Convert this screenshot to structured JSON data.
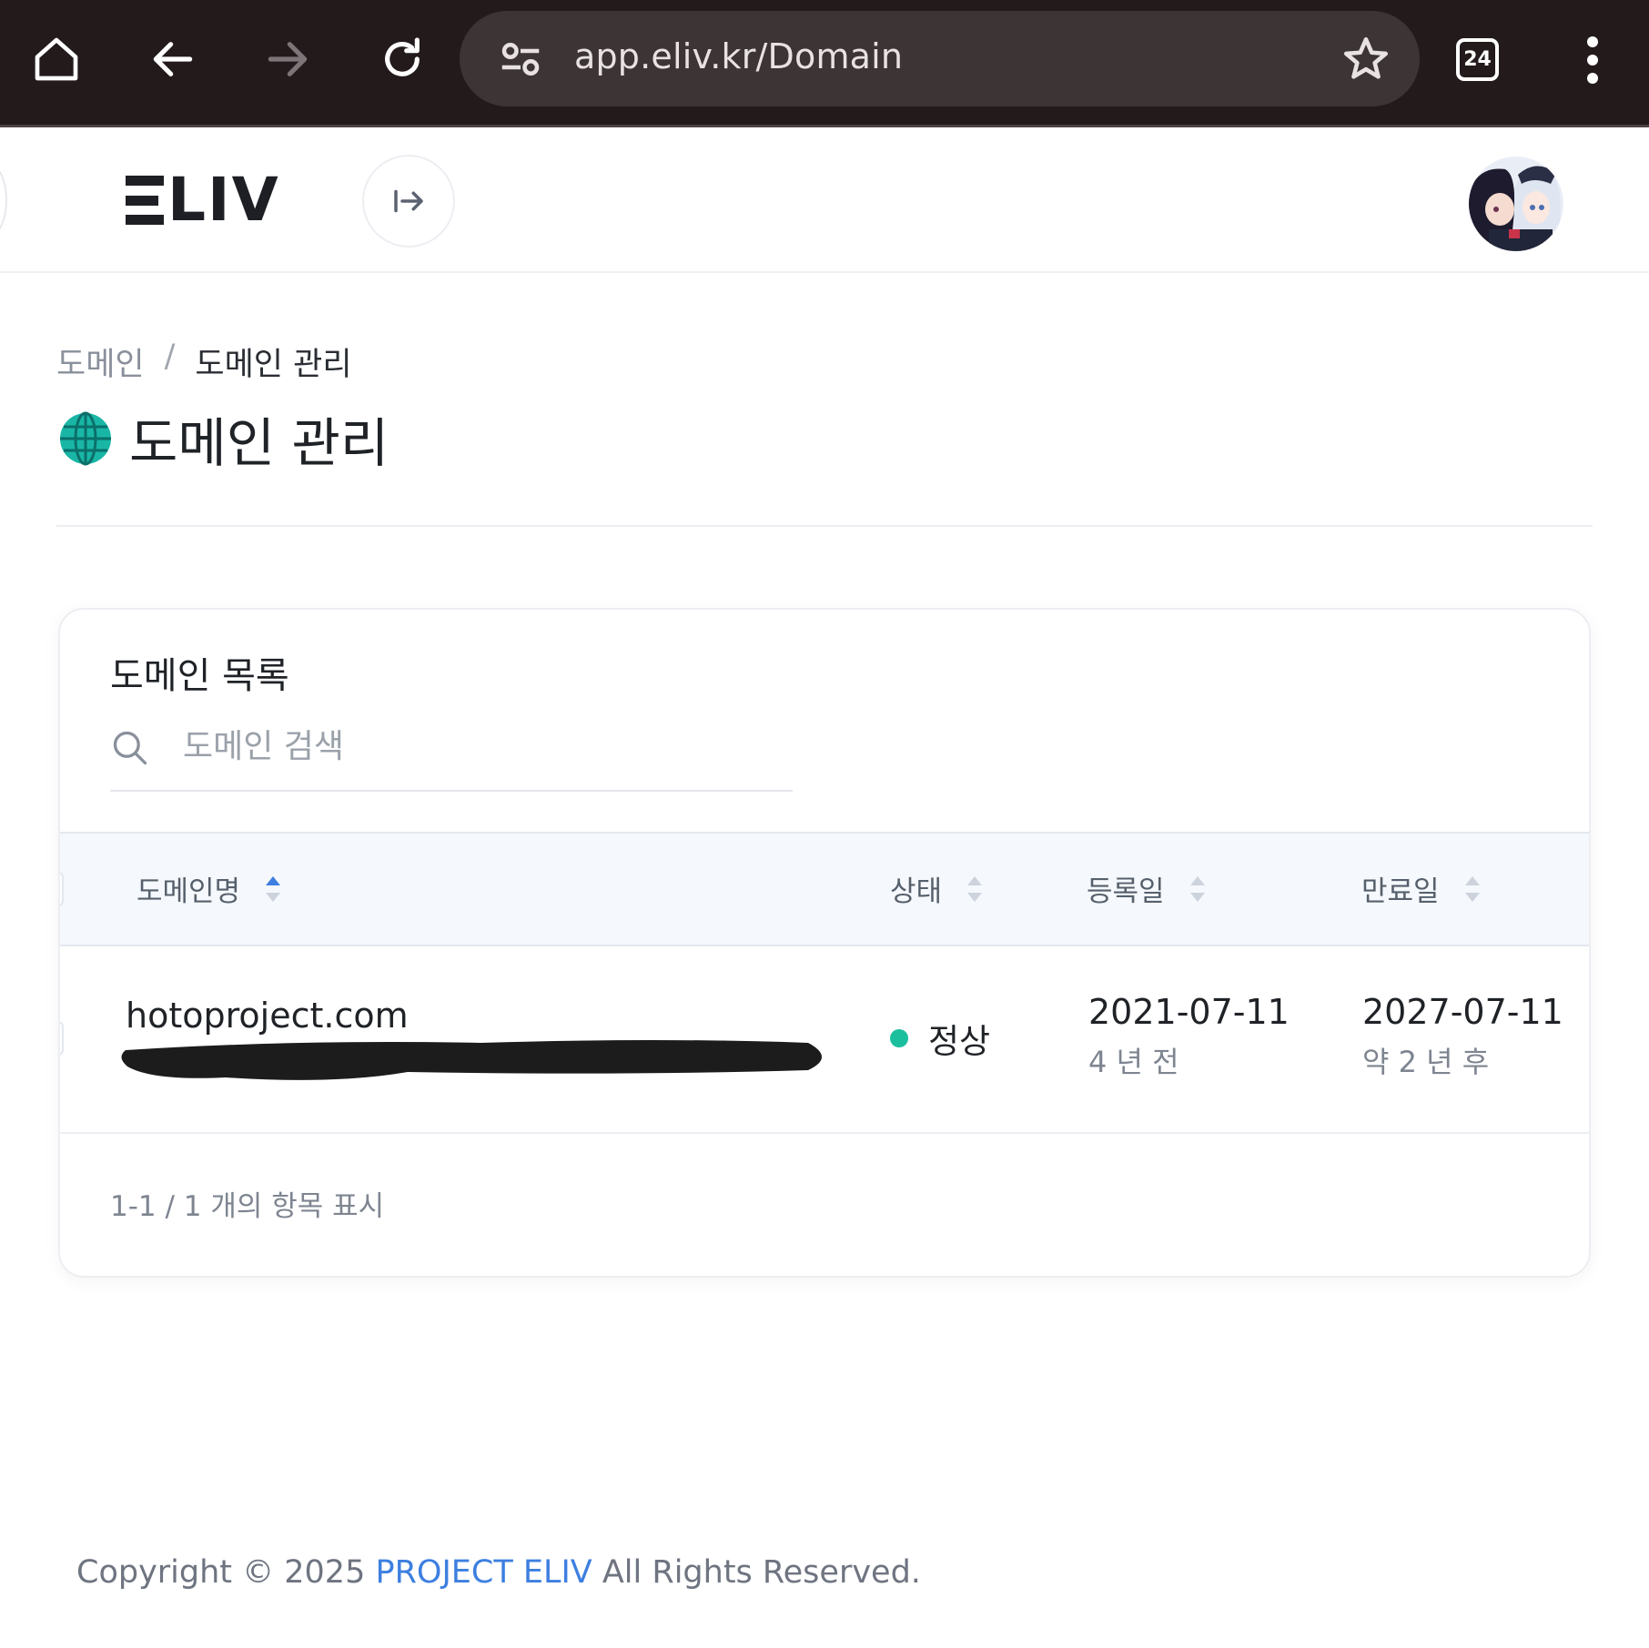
{
  "browser": {
    "url": "app.eliv.kr/Domain",
    "tab_count": "24",
    "icons": [
      "home-icon",
      "back-icon",
      "forward-icon",
      "reload-icon",
      "site-settings-icon",
      "bookmark-star-icon",
      "tabs-icon",
      "menu-kebab-icon"
    ]
  },
  "header": {
    "logo_text": "LIV",
    "logo_aria": "ELIV"
  },
  "breadcrumb": {
    "parent": "도메인",
    "separator": "/",
    "current": "도메인 관리"
  },
  "page": {
    "title": "도메인 관리",
    "title_icon": "globe-icon"
  },
  "domain_list": {
    "title": "도메인 목록",
    "search_placeholder": "도메인 검색",
    "columns": {
      "domain": "도메인명",
      "status": "상태",
      "registered": "등록일",
      "expires": "만료일"
    },
    "rows": [
      {
        "domain": "hotoproject.com",
        "status": "정상",
        "registered_date": "2021-07-11",
        "registered_relative": "4 년 전",
        "expires_date": "2027-07-11",
        "expires_relative": "약 2 년 후"
      }
    ],
    "summary": "1-1 / 1 개의 항목 표시"
  },
  "footer": {
    "prefix": "Copyright © 2025",
    "brand": "PROJECT ELIV",
    "suffix": "All Rights Reserved."
  },
  "colors": {
    "browser_bar": "#231a1c",
    "accent_blue": "#3d7fe0",
    "status_ok": "#1bbf9e",
    "table_header_bg": "#f5f8fc"
  }
}
